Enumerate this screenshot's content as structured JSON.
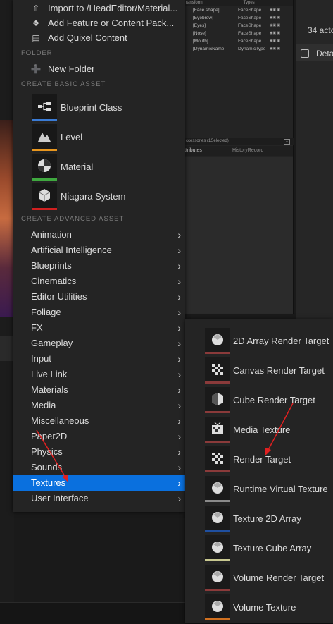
{
  "outliner": {
    "header": {
      "col1": "ransform",
      "col2": "Types"
    },
    "rows": [
      {
        "name": "[Face shape]",
        "type": "FaceShape"
      },
      {
        "name": "[Eyebrow]",
        "type": "FaceShape"
      },
      {
        "name": "[Eyes]",
        "type": "FaceShape"
      },
      {
        "name": "[Nose]",
        "type": "FaceShape"
      },
      {
        "name": "[Mouth]",
        "type": "FaceShape"
      },
      {
        "name": "[DynamicName]",
        "type": "DynamicType"
      }
    ],
    "accessories_label": "ccessories (1Selected)",
    "tabs": {
      "attributes": "ttributes",
      "history": "HistoryRecord"
    }
  },
  "details": {
    "actor_count": "34 acto",
    "tab_label": "Deta"
  },
  "menu": {
    "top_items": [
      {
        "label": "Import to /HeadEditor/Material...",
        "icon": "import-icon"
      },
      {
        "label": "Add Feature or Content Pack...",
        "icon": "feature-pack-icon"
      },
      {
        "label": "Add Quixel Content",
        "icon": "quixel-icon"
      }
    ],
    "folder_section": "FOLDER",
    "new_folder": {
      "label": "New Folder",
      "icon": "new-folder-icon"
    },
    "basic_section": "CREATE BASIC ASSET",
    "basic_assets": [
      {
        "label": "Blueprint Class",
        "icon": "blueprint-icon",
        "color": "#3a7bd5"
      },
      {
        "label": "Level",
        "icon": "level-icon",
        "color": "#e8961e"
      },
      {
        "label": "Material",
        "icon": "material-icon",
        "color": "#3fa83f"
      },
      {
        "label": "Niagara System",
        "icon": "niagara-icon",
        "color": "#d02020"
      }
    ],
    "advanced_section": "CREATE ADVANCED ASSET",
    "categories": [
      "Animation",
      "Artificial Intelligence",
      "Blueprints",
      "Cinematics",
      "Editor Utilities",
      "Foliage",
      "FX",
      "Gameplay",
      "Input",
      "Live Link",
      "Materials",
      "Media",
      "Miscellaneous",
      "Paper2D",
      "Physics",
      "Sounds",
      "Textures",
      "User Interface"
    ],
    "active_category": "Textures"
  },
  "submenu": {
    "items": [
      {
        "label": "2D Array Render Target",
        "icon": "render-target-icon",
        "color": "#8a3a3a"
      },
      {
        "label": "Canvas Render Target",
        "icon": "checker-texture-icon",
        "color": "#8a3a3a"
      },
      {
        "label": "Cube Render Target",
        "icon": "cube-render-target-icon",
        "color": "#8a3a3a"
      },
      {
        "label": "Media Texture",
        "icon": "media-texture-icon",
        "color": "#8a3a3a"
      },
      {
        "label": "Render Target",
        "icon": "checker-texture-icon",
        "color": "#8a3a3a"
      },
      {
        "label": "Runtime Virtual Texture",
        "icon": "runtime-virtual-texture-icon",
        "color": "#8a8a8a"
      },
      {
        "label": "Texture 2D Array",
        "icon": "texture-2d-array-icon",
        "color": "#1f4fa0"
      },
      {
        "label": "Texture Cube Array",
        "icon": "texture-cube-array-icon",
        "color": "#c8c890"
      },
      {
        "label": "Volume Render Target",
        "icon": "volume-render-target-icon",
        "color": "#8a3a3a"
      },
      {
        "label": "Volume Texture",
        "icon": "volume-texture-icon",
        "color": "#d07020"
      }
    ]
  },
  "annotations": {
    "arrow_color": "#e02020"
  }
}
